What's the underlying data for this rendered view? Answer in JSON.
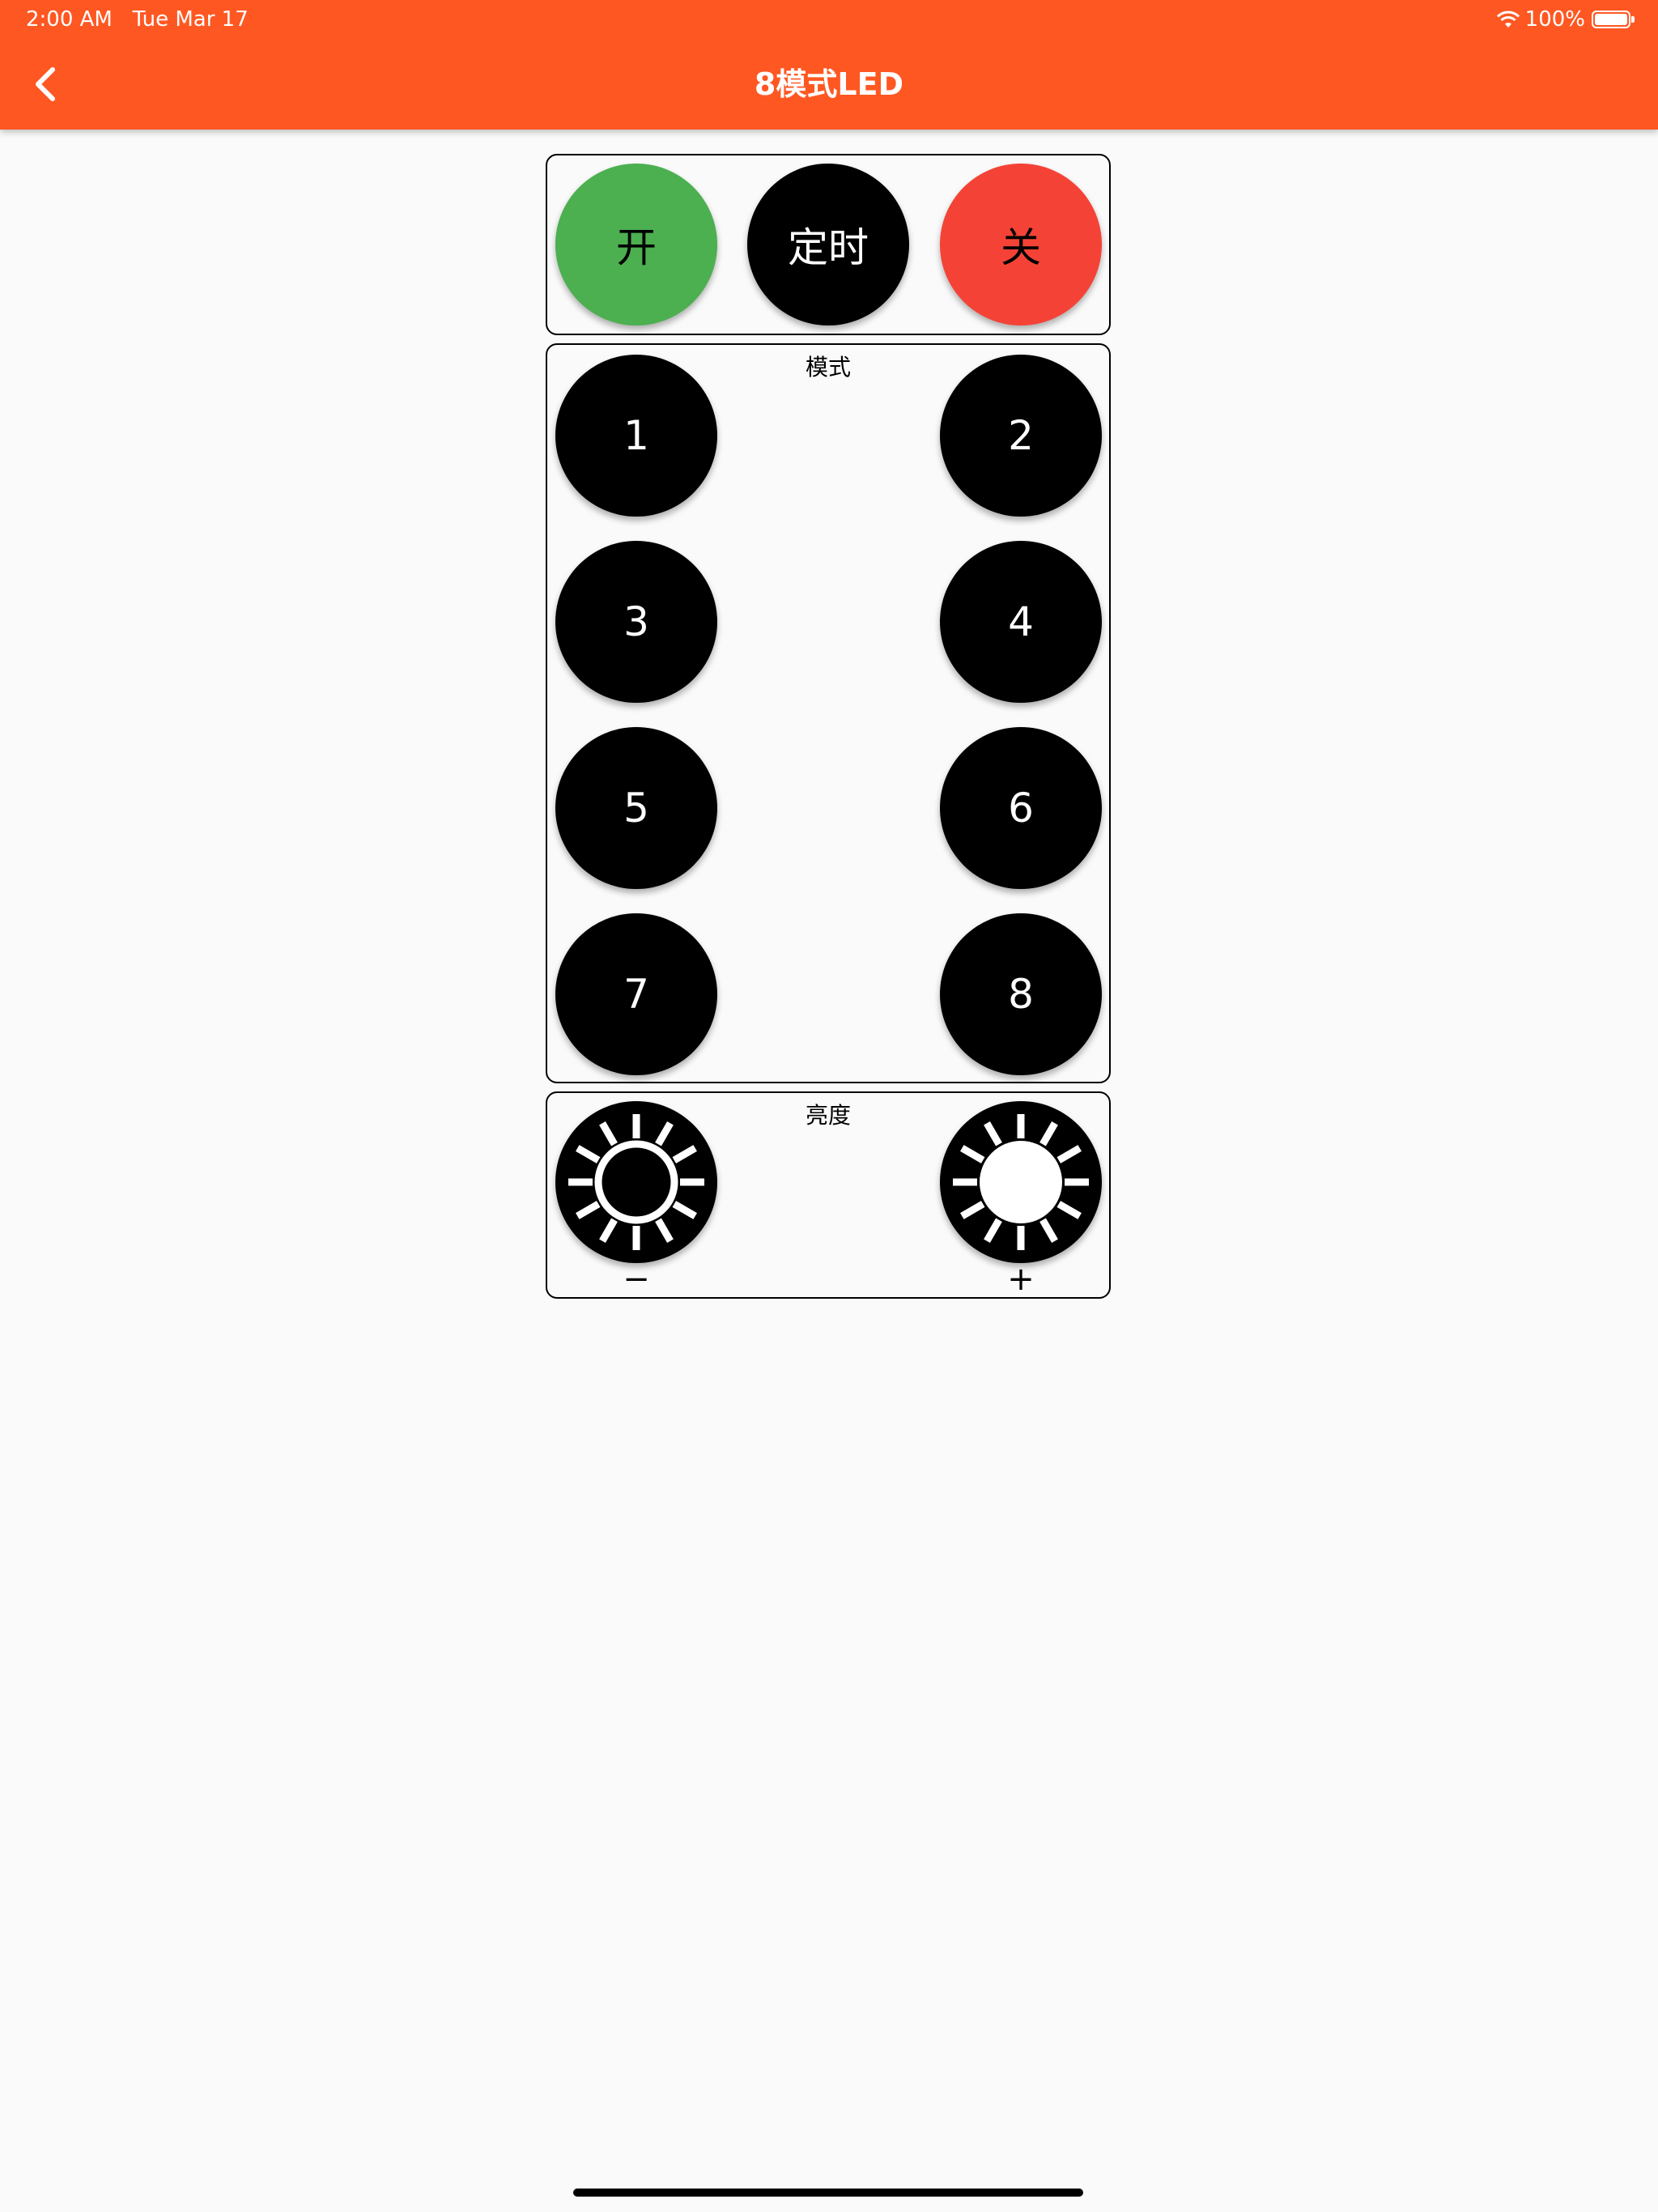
{
  "status_bar": {
    "time": "2:00 AM",
    "date": "Tue Mar 17",
    "battery": "100%"
  },
  "app_bar": {
    "title": "8模式LED",
    "back_icon": "chevron-left-icon"
  },
  "power_panel": {
    "on_label": "开",
    "timer_label": "定时",
    "off_label": "关"
  },
  "mode_panel": {
    "label": "模式",
    "buttons": [
      "1",
      "2",
      "3",
      "4",
      "5",
      "6",
      "7",
      "8"
    ]
  },
  "brightness_panel": {
    "label": "亮度",
    "minus_symbol": "−",
    "plus_symbol": "+",
    "decrease_icon": "brightness-low-icon",
    "increase_icon": "brightness-high-icon"
  },
  "colors": {
    "app_bar": "#ff5722",
    "on_button": "#4caf50",
    "off_button": "#f44336",
    "default_button": "#000000",
    "background": "#fafafa"
  }
}
